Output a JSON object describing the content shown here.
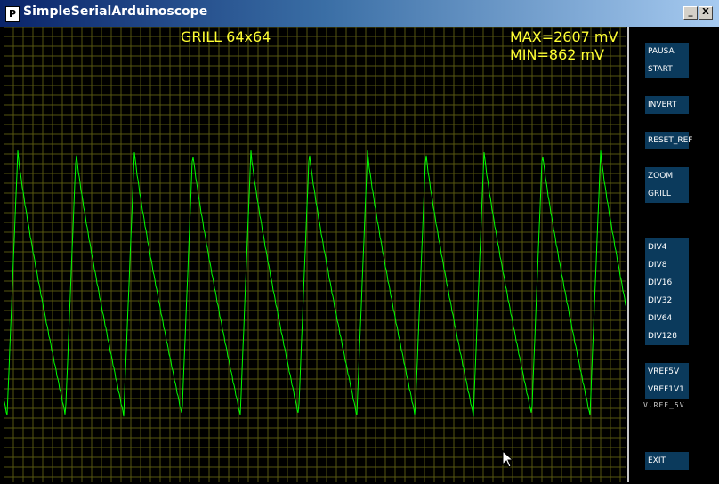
{
  "window": {
    "title": "SimpleSerialArduinoscope",
    "icon": "processing-p-icon",
    "minimize_glyph": "_",
    "close_glyph": "X"
  },
  "scope": {
    "mode_label": "GRILL 64x64",
    "max_label": "MAX=2607 mV",
    "min_label": "MIN=862 mV",
    "trace_color": "#00ff00",
    "grid_color": "#555510"
  },
  "panel": {
    "buttons": [
      "PAUSA",
      "START",
      "INVERT",
      "RESET_REF",
      "ZOOM",
      "GRILL",
      "DIV4",
      "DIV8",
      "DIV16",
      "DIV32",
      "DIV64",
      "DIV128",
      "VREF5V",
      "VREF1V1",
      "EXIT"
    ],
    "vref_status": "V.REF_5V"
  },
  "chart_data": {
    "type": "line",
    "series": [
      {
        "peaks_x_count": 11,
        "waveform": "sawtooth"
      }
    ]
  }
}
